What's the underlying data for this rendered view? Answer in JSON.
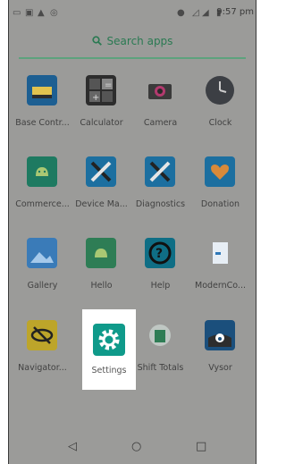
{
  "status_bar": {
    "time": "9:57 pm",
    "left_icons": [
      "notification-icon",
      "gallery-icon",
      "warning-icon",
      "sync-icon"
    ]
  },
  "search": {
    "label": "Search apps"
  },
  "apps": [
    {
      "label": "Base Contr..."
    },
    {
      "label": "Calculator"
    },
    {
      "label": "Camera"
    },
    {
      "label": "Clock"
    },
    {
      "label": "Commerce..."
    },
    {
      "label": "Device Ma..."
    },
    {
      "label": "Diagnostics"
    },
    {
      "label": "Donation"
    },
    {
      "label": "Gallery"
    },
    {
      "label": "Hello"
    },
    {
      "label": "Help"
    },
    {
      "label": "ModernCo..."
    },
    {
      "label": "Navigator..."
    },
    {
      "label": "Settings"
    },
    {
      "label": "Shift Totals"
    },
    {
      "label": "Vysor"
    }
  ]
}
